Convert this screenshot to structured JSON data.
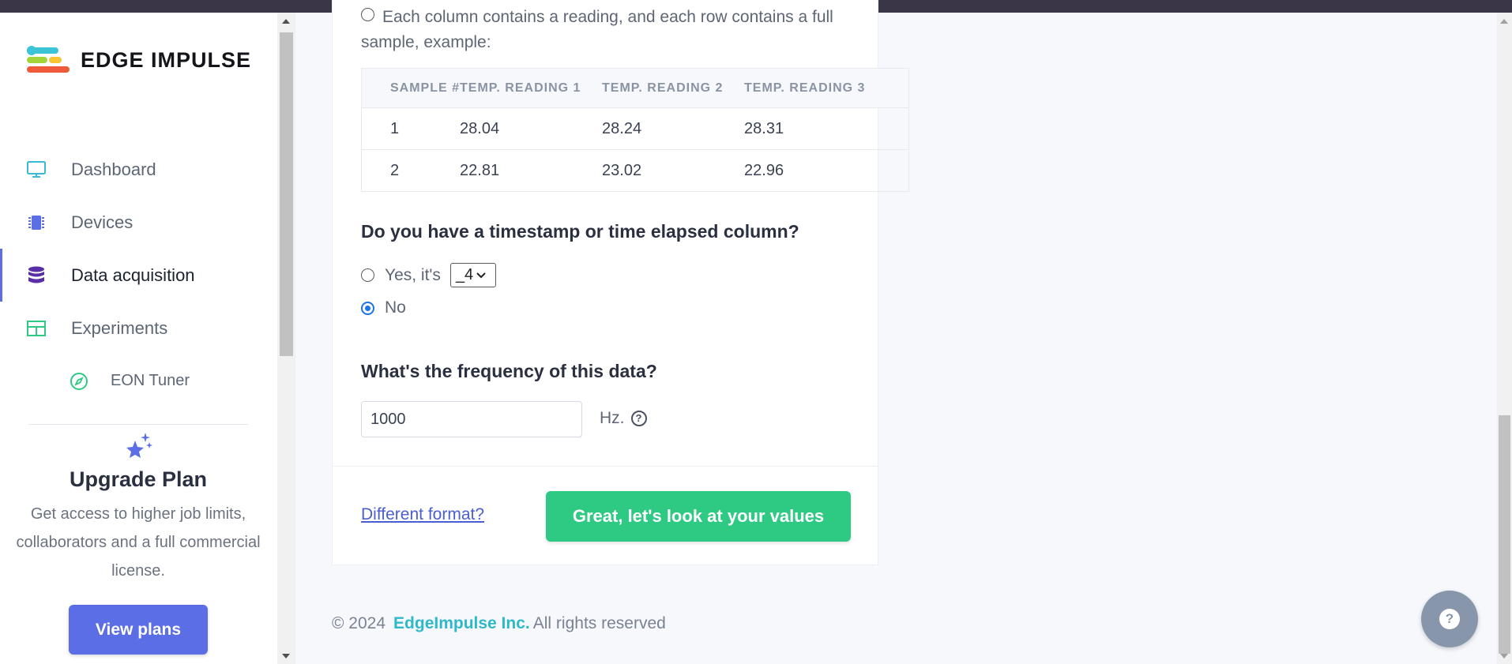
{
  "app": {
    "brand": "EDGE IMPULSE"
  },
  "sidebar": {
    "items": [
      {
        "label": "Dashboard",
        "icon": "monitor-icon",
        "color": "#3bb9d6"
      },
      {
        "label": "Devices",
        "icon": "chip-icon",
        "color": "#5b6ee6"
      },
      {
        "label": "Data acquisition",
        "icon": "database-icon",
        "color": "#5a2ea6",
        "active": true
      },
      {
        "label": "Experiments",
        "icon": "table-grid-icon",
        "color": "#2ec983"
      },
      {
        "label": "EON Tuner",
        "icon": "compass-icon",
        "color": "#2ec983"
      }
    ],
    "upgrade": {
      "title": "Upgrade Plan",
      "description": "Get access to higher job limits, collaborators and a full commercial license.",
      "button": "View plans"
    }
  },
  "form": {
    "intro": "Each column contains a reading, and each row contains a full sample, example:",
    "table": {
      "headers": [
        "SAMPLE #",
        "TEMP. READING 1",
        "TEMP. READING 2",
        "TEMP. READING 3"
      ],
      "rows": [
        [
          "1",
          "28.04",
          "28.24",
          "28.31"
        ],
        [
          "2",
          "22.81",
          "23.02",
          "22.96"
        ]
      ]
    },
    "timestamp_question": "Do you have a timestamp or time elapsed column?",
    "timestamp_yes_label": "Yes, it's",
    "timestamp_column_value": "_4",
    "timestamp_no_label": "No",
    "timestamp_selected": "No",
    "frequency_question": "What's the frequency of this data?",
    "frequency_value": "1000",
    "frequency_unit": "Hz.",
    "different_format": "Different format?",
    "submit": "Great, let's look at your values"
  },
  "footer": {
    "copyright": "© 2024",
    "company": "EdgeImpulse Inc.",
    "rights": "All rights reserved"
  },
  "colors": {
    "accent": "#5b6ee6",
    "success": "#2ec983",
    "brand_teal": "#2fb8c9"
  }
}
